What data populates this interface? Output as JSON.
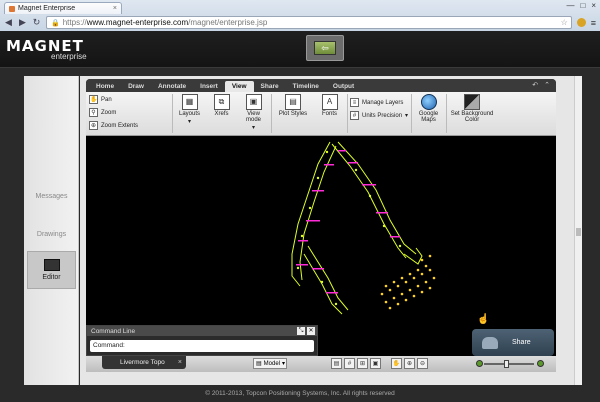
{
  "browser": {
    "tab_title": "Magnet Enterprise",
    "tab_close": "×",
    "window_controls": [
      "—",
      "□",
      "×"
    ],
    "nav": {
      "back": "◀",
      "forward": "▶",
      "reload": "↻"
    },
    "url_protocol": "https://",
    "url_host": "www.magnet-enterprise.com",
    "url_path": "/magnet/enterprise.jsp",
    "star": "☆",
    "menu": "≡"
  },
  "header": {
    "logo": "MAGNET",
    "logo_sub": "enterprise"
  },
  "sidebar": {
    "items": [
      {
        "label": "Messages"
      },
      {
        "label": "Drawings"
      },
      {
        "label": "Editor"
      }
    ]
  },
  "ribbon": {
    "tabs": [
      "Home",
      "Draw",
      "Annotate",
      "Insert",
      "View",
      "Share",
      "Timeline",
      "Output"
    ],
    "active_tab": "View",
    "nav_group": {
      "pan": "Pan",
      "zoom": "Zoom",
      "zoom_extents": "Zoom Extents"
    },
    "layouts": "Layouts",
    "xrefs": "Xrefs",
    "view_mode": "View mode",
    "plot_styles": "Plot Styles",
    "fonts": "Fonts",
    "manage_layers": "Manage Layers",
    "units_precision": "Units Precision",
    "google_maps": "Google Maps",
    "set_background": "Set Background Color"
  },
  "command": {
    "title": "Command Line",
    "input_value": "Command:"
  },
  "bottombar": {
    "doc_tab": "Livermore Topo",
    "doc_close": "×",
    "model": "Model",
    "model_arrow": "▾"
  },
  "share": {
    "label": "Share"
  },
  "footer": {
    "text": "© 2011-2013, Topcon Positioning Systems, Inc.  All rights reserved"
  }
}
